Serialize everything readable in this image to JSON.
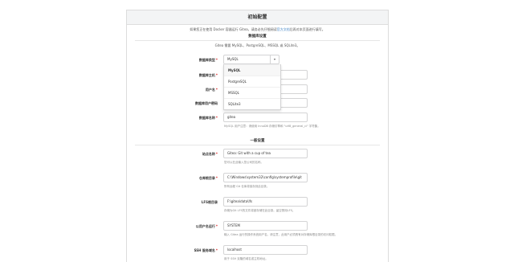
{
  "panel": {
    "title": "初始配置"
  },
  "intro": {
    "before": "如果您正在使用 Docker 容器运行 Gitea，请务必先仔细阅读",
    "link": "官方文档",
    "after": "后再对本页面进行填写。"
  },
  "database": {
    "section_title": "数据库设置",
    "note": "Gitea 需要 MySQL、PostgreSQL、MSSQL 或 SQLite3。",
    "type_label": "数据库类型",
    "type_value": "MySQL",
    "type_options": [
      "MySQL",
      "PostgreSQL",
      "MSSQL",
      "SQLite3"
    ],
    "host_label": "数据库主机",
    "user_label": "用户名",
    "password_label": "数据库用户密码",
    "name_label": "数据库名称",
    "name_value": "gitea",
    "name_help": "MySQL 用户注意：请使用 InnoDB 存储引擎和 \"utf8_general_ci\" 字符集。"
  },
  "general": {
    "section_title": "一般设置",
    "app_name_label": "站点名称",
    "app_name_value": "Gitea: Git with a cup of tea",
    "app_name_help": "您可以在此输入您公司的名称。",
    "repo_root_label": "仓库根目录",
    "repo_root_value": "C:\\Windows\\system32\\config\\systemprofile\\git",
    "repo_root_help": "所有远程 Git 仓库将保存到此目录。",
    "lfs_label": "LFS根目录",
    "lfs_value": "F:\\gitea\\data\\lfs",
    "lfs_help": "存储为Git LFS的文件将被存储在此目录。留空禁用LFS。",
    "run_user_label": "以用户名运行",
    "run_user_value": "SYSTEM",
    "run_user_help": "输入 Gitea 运行的操作系统用户名。请注意，此用户必须具有对存储库根目录的访问权限。",
    "ssh_label": "SSH 服务域名",
    "ssh_value": "localhost",
    "ssh_help": "用于 SSH 克隆的域名或主机地址。"
  }
}
